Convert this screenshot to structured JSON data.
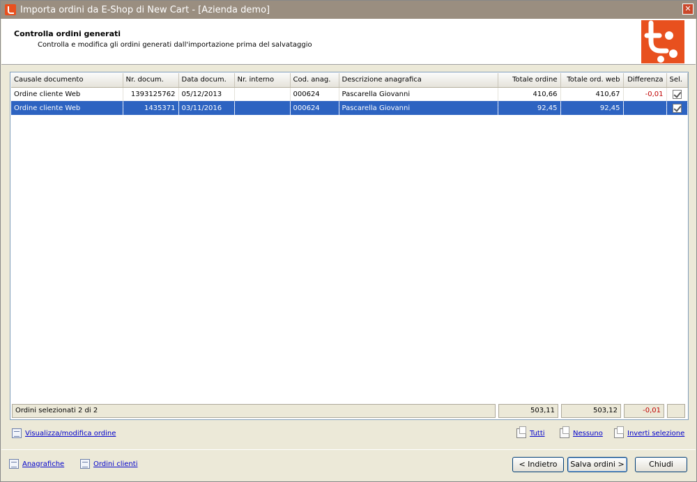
{
  "window": {
    "title": "Importa ordini da E-Shop di New Cart - [Azienda demo]",
    "close_glyph": "✕"
  },
  "header": {
    "title": "Controlla ordini generati",
    "subtitle": "Controlla e modifica gli ordini generati dall'importazione prima del salvataggio"
  },
  "grid": {
    "columns": [
      "Causale documento",
      "Nr. docum.",
      "Data docum.",
      "Nr. interno",
      "Cod. anag.",
      "Descrizione anagrafica",
      "Totale ordine",
      "Totale ord. web",
      "Differenza",
      "Sel."
    ],
    "rows": [
      {
        "causale": "Ordine cliente Web",
        "nr_docum": "1393125762",
        "data_docum": "05/12/2013",
        "nr_interno": "",
        "cod_anag": "000624",
        "descrizione": "Pascarella Giovanni",
        "totale_ordine": "410,66",
        "totale_web": "410,67",
        "differenza": "-0,01",
        "selected": true
      },
      {
        "causale": "Ordine cliente Web",
        "nr_docum": "1435371",
        "data_docum": "03/11/2016",
        "nr_interno": "",
        "cod_anag": "000624",
        "descrizione": "Pascarella Giovanni",
        "totale_ordine": "92,45",
        "totale_web": "92,45",
        "differenza": "",
        "selected": true
      }
    ],
    "footer": {
      "summary": "Ordini selezionati 2 di 2",
      "totale_ordine": "503,11",
      "totale_web": "503,12",
      "differenza": "-0,01"
    }
  },
  "links": {
    "view_order": "Visualizza/modifica ordine",
    "all": "Tutti",
    "none": "Nessuno",
    "invert": "Inverti selezione",
    "registry": "Anagrafiche",
    "client_orders": "Ordini clienti"
  },
  "buttons": {
    "back": "< Indietro",
    "save": "Salva ordini >",
    "close": "Chiudi"
  },
  "colors": {
    "selection": "#2d63c1",
    "negative": "#c00000",
    "logo": "#e8501e"
  }
}
